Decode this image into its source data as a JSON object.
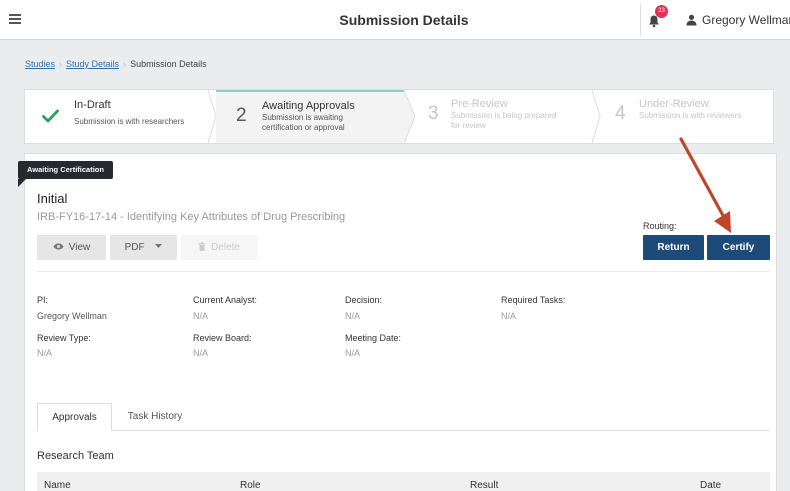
{
  "header": {
    "title": "Submission Details",
    "notification_count": "23",
    "user_name": "Gregory Wellman"
  },
  "breadcrumb": {
    "items": [
      "Studies",
      "Study Details",
      "Submission Details"
    ]
  },
  "stepper": {
    "steps": [
      {
        "number": "",
        "title": "In-Draft",
        "description": "Submission is with researchers",
        "state": "completed"
      },
      {
        "number": "2",
        "title": "Awaiting Approvals",
        "description_line1": "Submission is awaiting",
        "description_line2": "certification or approval",
        "state": "active"
      },
      {
        "number": "3",
        "title": "Pre-Review",
        "description_line1": "Submission is being prepared",
        "description_line2": "for review",
        "state": "disabled"
      },
      {
        "number": "4",
        "title": "Under-Review",
        "description": "Submission is with reviewers",
        "state": "disabled"
      }
    ]
  },
  "submission": {
    "status_flag": "Awaiting Certification",
    "type": "Initial",
    "title": "IRB-FY16-17-14 - Identifying Key Attributes of Drug Prescribing",
    "actions": {
      "view": "View",
      "pdf": "PDF",
      "delete": "Delete"
    },
    "routing": {
      "label": "Routing:",
      "return": "Return",
      "certify": "Certify"
    }
  },
  "details": {
    "pi_label": "PI:",
    "pi_value": "Gregory Wellman",
    "analyst_label": "Current Analyst:",
    "analyst_value": "N/A",
    "decision_label": "Decision:",
    "decision_value": "N/A",
    "tasks_label": "Required Tasks:",
    "tasks_value": "N/A",
    "review_type_label": "Review Type:",
    "review_type_value": "N/A",
    "review_board_label": "Review Board:",
    "review_board_value": "N/A",
    "meeting_date_label": "Meeting Date:",
    "meeting_date_value": "N/A"
  },
  "tabs": [
    {
      "label": "Approvals",
      "active": true
    },
    {
      "label": "Task History",
      "active": false
    }
  ],
  "research_team": {
    "heading": "Research Team",
    "columns": [
      "Name",
      "Role",
      "Result",
      "Date"
    ]
  },
  "colors": {
    "primary_button": "#1c4a79",
    "check_green": "#2e9e5b",
    "active_step_accent": "#8bd2c5",
    "badge": "#e5305a",
    "annotation_arrow": "#c0452b"
  }
}
